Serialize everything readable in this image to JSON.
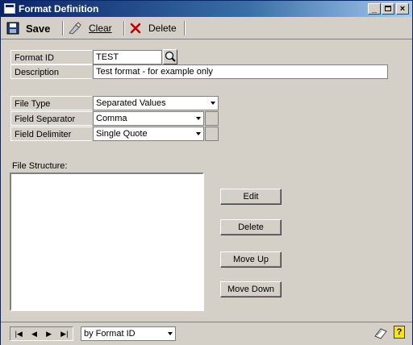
{
  "window": {
    "title": "Format Definition"
  },
  "toolbar": {
    "save_label": "Save",
    "clear_label": "Clear",
    "delete_label": "Delete"
  },
  "form": {
    "format_id_label": "Format ID",
    "format_id_value": "TEST",
    "description_label": "Description",
    "description_value": "Test format - for example only",
    "file_type_label": "File Type",
    "file_type_value": "Separated Values",
    "field_separator_label": "Field Separator",
    "field_separator_value": "Comma",
    "field_delimiter_label": "Field Delimiter",
    "field_delimiter_value": "Single Quote",
    "file_structure_label": "File Structure:"
  },
  "buttons": {
    "edit": "Edit",
    "delete": "Delete",
    "move_up": "Move Up",
    "move_down": "Move Down"
  },
  "statusbar": {
    "sort_value": "by Format ID"
  },
  "icons": [
    "save-icon",
    "clear-icon",
    "delete-icon",
    "lookup-icon",
    "note-icon",
    "help-icon"
  ]
}
